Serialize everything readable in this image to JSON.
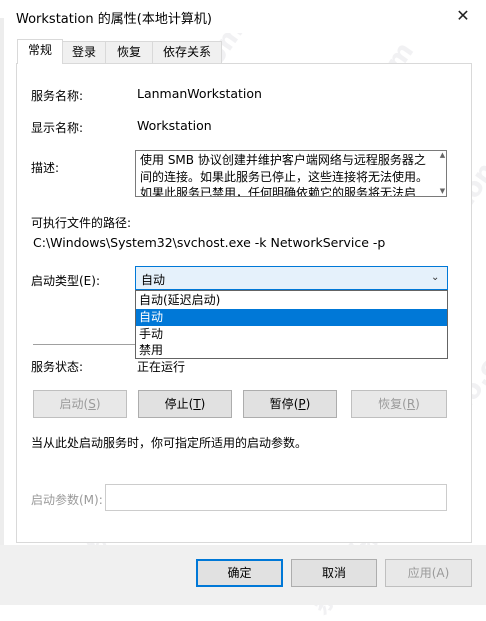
{
  "window": {
    "title": "Workstation 的属性(本地计算机)",
    "close_glyph": "✕"
  },
  "tabs": [
    {
      "label": "常规",
      "active": true
    },
    {
      "label": "登录",
      "active": false
    },
    {
      "label": "恢复",
      "active": false
    },
    {
      "label": "依存关系",
      "active": false
    }
  ],
  "general": {
    "service_name_label": "服务名称:",
    "service_name": "LanmanWorkstation",
    "display_name_label": "显示名称:",
    "display_name": "Workstation",
    "description_label": "描述:",
    "description": "使用 SMB 协议创建并维护客户端网络与远程服务器之间的连接。如果此服务已停止，这些连接将无法使用。如果此服务已禁用，任何明确依赖它的服务将无法启动。",
    "exe_path_label": "可执行文件的路径:",
    "exe_path": "C:\\Windows\\System32\\svchost.exe -k NetworkService -p",
    "startup_type_label": "启动类型(E):",
    "startup_type_value": "自动",
    "startup_options": [
      {
        "label": "自动(延迟启动)",
        "selected": false
      },
      {
        "label": "自动",
        "selected": true
      },
      {
        "label": "手动",
        "selected": false
      },
      {
        "label": "禁用",
        "selected": false
      }
    ],
    "service_status_label": "服务状态:",
    "service_status": "正在运行",
    "buttons": {
      "start": {
        "text": "启动",
        "key": "S",
        "enabled": false
      },
      "stop": {
        "text": "停止",
        "key": "T",
        "enabled": true
      },
      "pause": {
        "text": "暂停",
        "key": "P",
        "enabled": true
      },
      "resume": {
        "text": "恢复",
        "key": "R",
        "enabled": false
      }
    },
    "start_hint": "当从此处启动服务时，你可指定所适用的启动参数。",
    "start_params_label": "启动参数(M):",
    "start_params_value": ""
  },
  "footer": {
    "ok": "确定",
    "cancel": "取消",
    "apply": "应用(A)"
  },
  "watermark": "系统部落xitongbuluo.com",
  "colors": {
    "accent": "#0078d7",
    "combo_bg": "#e5f1fb",
    "disabled_text": "#9a9a9a"
  }
}
